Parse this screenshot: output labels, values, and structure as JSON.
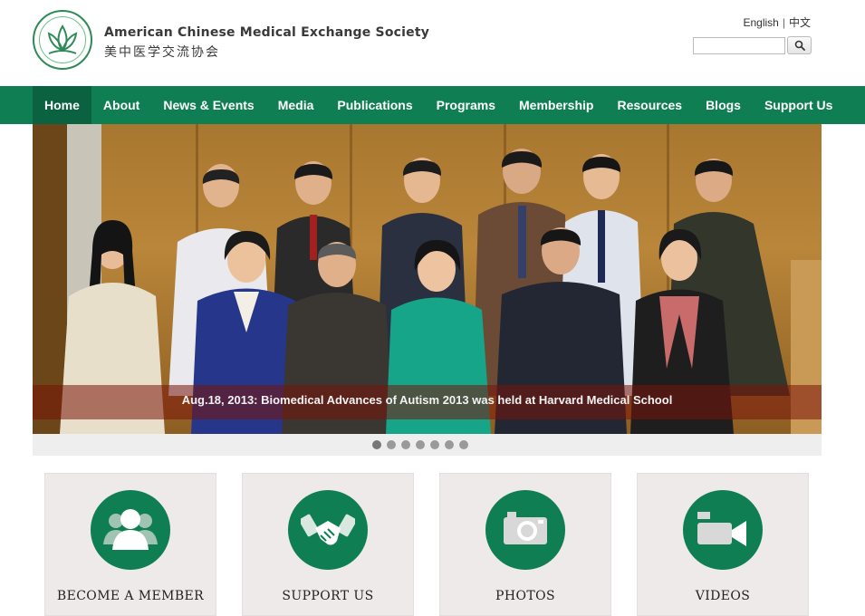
{
  "header": {
    "title": "American Chinese Medical Exchange Society",
    "subtitle": "美中医学交流协会",
    "lang_en": "English",
    "lang_sep": "|",
    "lang_cn": "中文",
    "search_placeholder": "",
    "search_icon": "search-icon"
  },
  "nav": {
    "items": [
      "Home",
      "About",
      "News & Events",
      "Media",
      "Publications",
      "Programs",
      "Membership",
      "Resources",
      "Blogs",
      "Support Us"
    ],
    "active": "Home"
  },
  "slider": {
    "caption": "Aug.18, 2013: Biomedical Advances of Autism 2013 was held at Harvard Medical School",
    "dot_count": 7,
    "active_dot": 1
  },
  "features": [
    {
      "label": "BECOME A MEMBER",
      "icon": "users-icon"
    },
    {
      "label": "SUPPORT US",
      "icon": "handshake-icon"
    },
    {
      "label": "PHOTOS",
      "icon": "camera-icon"
    },
    {
      "label": "VIDEOS",
      "icon": "video-camera-icon"
    }
  ],
  "colors": {
    "brand_green": "#0f7e52",
    "active_nav": "#0a6240",
    "caption_bg": "#7a140a"
  }
}
